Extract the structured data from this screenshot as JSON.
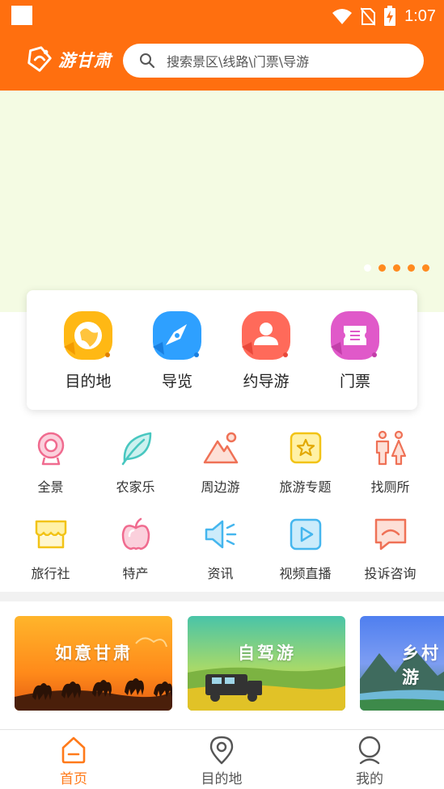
{
  "status_bar": {
    "time": "1:07"
  },
  "header": {
    "logo_text": "游甘肃",
    "search_placeholder": "搜索景区\\线路\\门票\\导游"
  },
  "banner": {
    "dot_count": 5,
    "active_dot": 1
  },
  "quick_card": {
    "items": [
      {
        "label": "目的地",
        "icon": "globe-icon",
        "color": "#ffb814"
      },
      {
        "label": "导览",
        "icon": "compass-icon",
        "color": "#2ea0ff"
      },
      {
        "label": "约导游",
        "icon": "person-icon",
        "color": "#ff6a5a"
      },
      {
        "label": "门票",
        "icon": "ticket-icon",
        "color": "#e059c9"
      }
    ]
  },
  "grid": {
    "items": [
      {
        "label": "全景",
        "icon": "panorama-camera-icon"
      },
      {
        "label": "农家乐",
        "icon": "leaf-icon"
      },
      {
        "label": "周边游",
        "icon": "mountain-icon"
      },
      {
        "label": "旅游专题",
        "icon": "star-badge-icon"
      },
      {
        "label": "找厕所",
        "icon": "restroom-icon"
      },
      {
        "label": "旅行社",
        "icon": "shop-awning-icon"
      },
      {
        "label": "特产",
        "icon": "apple-icon"
      },
      {
        "label": "资讯",
        "icon": "speaker-icon"
      },
      {
        "label": "视频直播",
        "icon": "play-video-icon"
      },
      {
        "label": "投诉咨询",
        "icon": "complaint-chat-icon"
      }
    ]
  },
  "promos": [
    {
      "title": "如意甘肃"
    },
    {
      "title": "自驾游"
    },
    {
      "title": "乡村游"
    }
  ],
  "bottom_nav": {
    "items": [
      {
        "label": "首页",
        "active": true,
        "icon": "home-icon"
      },
      {
        "label": "目的地",
        "active": false,
        "icon": "location-pin-icon"
      },
      {
        "label": "我的",
        "active": false,
        "icon": "user-icon"
      }
    ]
  },
  "colors": {
    "brand": "#ff6f0f",
    "accent": "#ff7a1a",
    "banner_bg": "#f4fbe3"
  }
}
